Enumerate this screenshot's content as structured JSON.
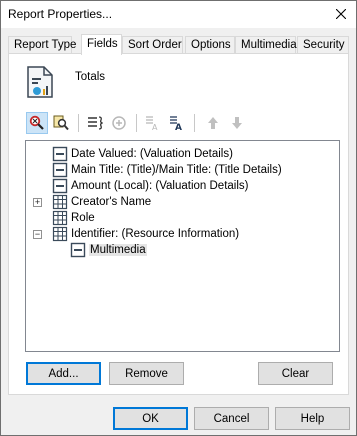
{
  "window": {
    "title": "Report Properties..."
  },
  "tabs": [
    {
      "label": "Report Type"
    },
    {
      "label": "Fields"
    },
    {
      "label": "Sort Order"
    },
    {
      "label": "Options"
    },
    {
      "label": "Multimedia"
    },
    {
      "label": "Security"
    }
  ],
  "active_tab": "Fields",
  "report": {
    "name": "Totals"
  },
  "toolbar": {
    "buttons": [
      "find-field-icon",
      "find-all-icon",
      "properties-icon",
      "add-circle-icon",
      "text-a-icon",
      "text-a-bold-icon",
      "arrow-up-icon",
      "arrow-down-icon"
    ]
  },
  "tree": {
    "items": [
      {
        "label": "Date Valued: (Valuation Details)"
      },
      {
        "label": "Main Title: (Title)/Main Title: (Title Details)"
      },
      {
        "label": "Amount (Local): (Valuation Details)"
      },
      {
        "label": "Creator's Name"
      },
      {
        "label": "Role"
      },
      {
        "label": "Identifier: (Resource Information)"
      },
      {
        "label": "Multimedia"
      }
    ]
  },
  "panel_buttons": {
    "add": "Add...",
    "remove": "Remove",
    "clear": "Clear"
  },
  "dialog_buttons": {
    "ok": "OK",
    "cancel": "Cancel",
    "help": "Help"
  },
  "colors": {
    "accent": "#0078d7",
    "selected_row": "#e5e5e5",
    "field_icon": "#3a4a5a"
  }
}
